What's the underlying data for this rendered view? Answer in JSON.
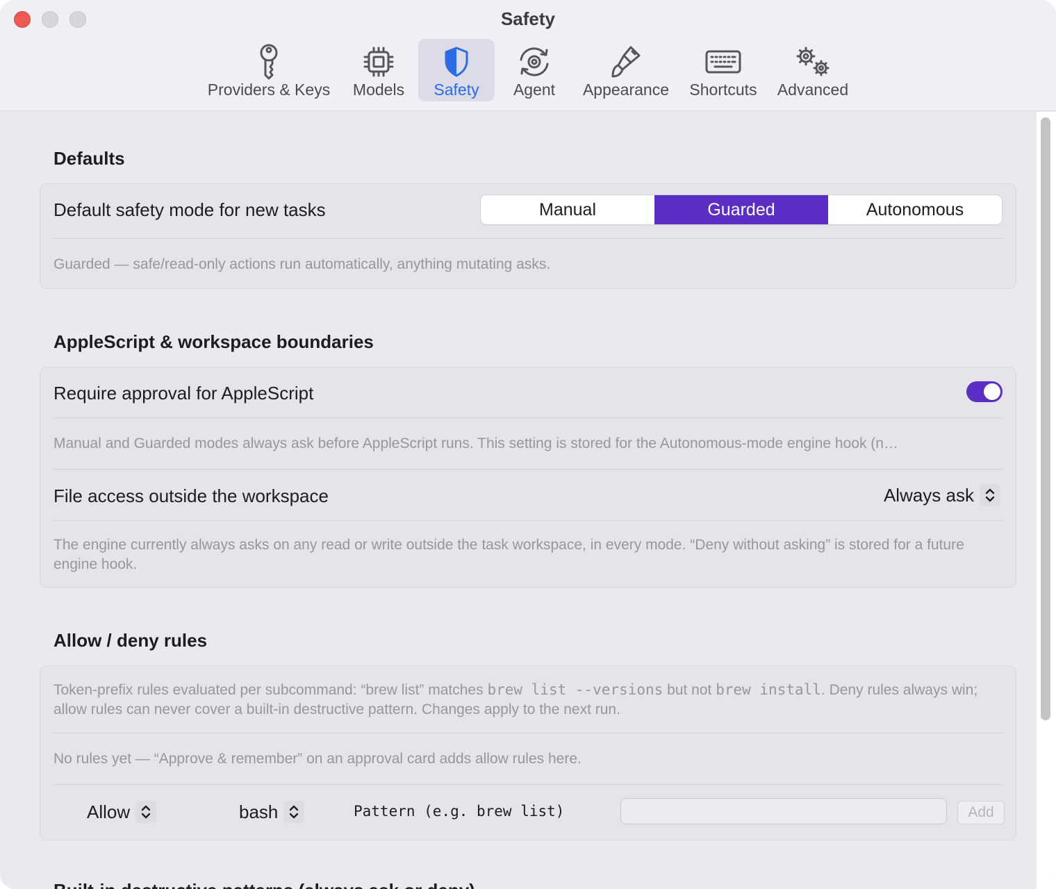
{
  "window": {
    "title": "Safety"
  },
  "toolbar": {
    "tabs": [
      {
        "label": "Providers & Keys",
        "icon": "key-icon",
        "active": false
      },
      {
        "label": "Models",
        "icon": "cpu-chip-icon",
        "active": false
      },
      {
        "label": "Safety",
        "icon": "shield-icon",
        "active": true
      },
      {
        "label": "Agent",
        "icon": "gear-cycle-icon",
        "active": false
      },
      {
        "label": "Appearance",
        "icon": "paintbrush-icon",
        "active": false
      },
      {
        "label": "Shortcuts",
        "icon": "keyboard-icon",
        "active": false
      },
      {
        "label": "Advanced",
        "icon": "gears-icon",
        "active": false
      }
    ]
  },
  "defaults": {
    "section_title": "Defaults",
    "mode_label": "Default safety mode for new tasks",
    "mode_options": [
      "Manual",
      "Guarded",
      "Autonomous"
    ],
    "mode_selected": "Guarded",
    "description": "Guarded — safe/read-only actions run automatically, anything mutating asks."
  },
  "boundaries": {
    "section_title": "AppleScript & workspace boundaries",
    "applescript_label": "Require approval for AppleScript",
    "applescript_enabled": true,
    "applescript_desc": "Manual and Guarded modes always ask before AppleScript runs. This setting is stored for the Autonomous-mode engine hook (n…",
    "file_access_label": "File access outside the workspace",
    "file_access_value": "Always ask",
    "file_access_desc": "The engine currently always asks on any read or write outside the task workspace, in every mode. “Deny without asking” is stored for a future engine hook."
  },
  "rules": {
    "section_title": "Allow / deny rules",
    "desc_part1": "Token-prefix rules evaluated per subcommand: “brew list” matches ",
    "desc_code1": "brew list --versions",
    "desc_part2": " but not ",
    "desc_code2": "brew install",
    "desc_part3": ". Deny rules always win; allow rules can never cover a built-in destructive pattern. Changes apply to the next run.",
    "empty_text": "No rules yet — “Approve & remember” on an approval card adds allow rules here.",
    "action_value": "Allow",
    "tool_value": "bash",
    "pattern_label": "Pattern (e.g. brew list)",
    "pattern_value": "",
    "add_label": "Add"
  },
  "next_section_title": "Built-in destructive patterns (always ask or deny)",
  "colors": {
    "accent": "#5b2fc4",
    "tab_active": "#2a6be6",
    "close": "#ee5a52"
  }
}
